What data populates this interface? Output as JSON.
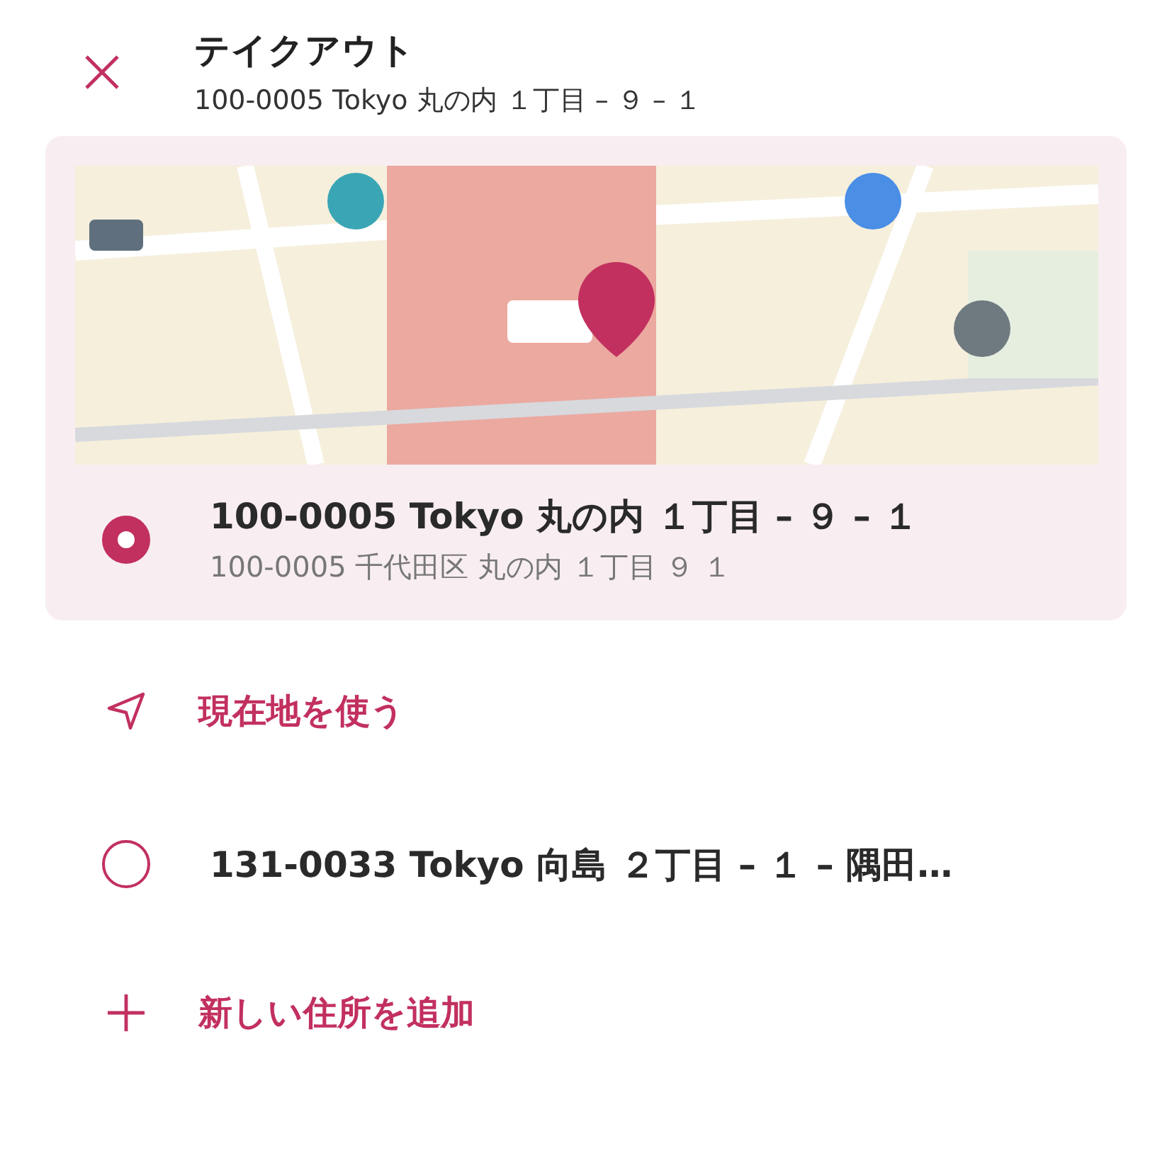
{
  "header": {
    "title": "テイクアウト",
    "subtitle": "100-0005 Tokyo 丸の内 １丁目 – ９ – １"
  },
  "options": [
    {
      "kind": "address",
      "title": "100-0005 Tokyo 丸の内 １丁目 – ９ – １",
      "detail": "100-0005 千代田区 丸の内 １丁目 ９ １",
      "selected": true
    },
    {
      "kind": "current_location",
      "label": "現在地を使う"
    },
    {
      "kind": "address",
      "title": "131-0033 Tokyo 向島 ２丁目 – １ – 隅田…",
      "selected": false
    },
    {
      "kind": "add",
      "label": "新しい住所を追加"
    }
  ]
}
